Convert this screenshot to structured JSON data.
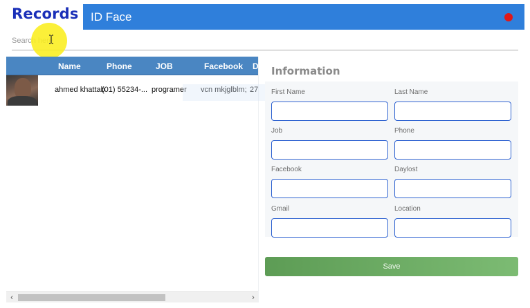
{
  "app": {
    "records_title": "Records",
    "top_bar_title": "ID Face",
    "close_color": "#e01818",
    "accent_color": "#2f7fdb"
  },
  "search": {
    "placeholder": "Search here",
    "value": ""
  },
  "grid": {
    "columns": [
      "Name",
      "Phone",
      "JOB",
      "Facebook",
      "D"
    ],
    "rows": [
      {
        "photo": "person-photo",
        "name": "ahmed khattab",
        "phone": "(01) 55234-...",
        "job": "programer",
        "facebook": "vcn mkjglblm;",
        "d": "27"
      }
    ]
  },
  "info": {
    "heading": "Information",
    "fields": {
      "first_name": {
        "label": "First Name",
        "value": ""
      },
      "last_name": {
        "label": "Last Name",
        "value": ""
      },
      "job": {
        "label": "Job",
        "value": ""
      },
      "phone": {
        "label": "Phone",
        "value": ""
      },
      "facebook": {
        "label": "Facebook",
        "value": ""
      },
      "daylost": {
        "label": "Daylost",
        "value": ""
      },
      "gmail": {
        "label": "Gmail",
        "value": ""
      },
      "location": {
        "label": "Location",
        "value": ""
      }
    },
    "save_label": "Save",
    "save_color": "#6aaa61"
  },
  "icons": {
    "scroll_left": "‹",
    "scroll_right": "›"
  }
}
